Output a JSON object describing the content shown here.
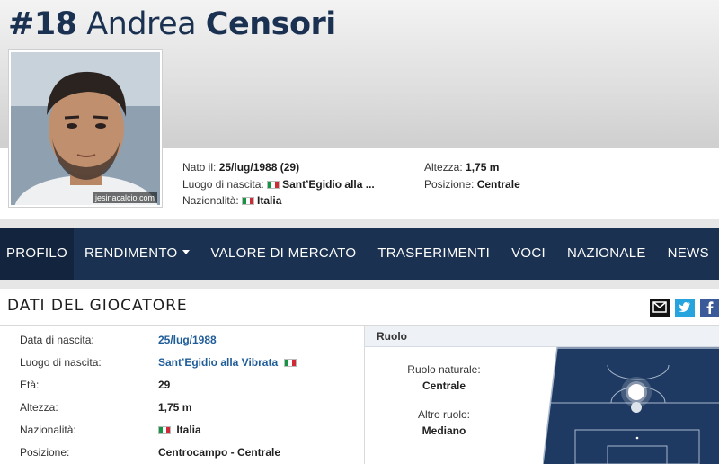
{
  "player": {
    "number": "#18",
    "first_name": "Andrea",
    "last_name": "Censori",
    "photo_credit": "jesinacalcio.com"
  },
  "header_facts": {
    "left": [
      {
        "label": "Nato il:",
        "value": "25/lug/1988 (29)",
        "flag": false
      },
      {
        "label": "Luogo di nascita:",
        "value": "Sant’Egidio alla ...",
        "flag": true
      },
      {
        "label": "Nazionalità:",
        "value": "Italia",
        "flag": true
      }
    ],
    "right": [
      {
        "label": "Altezza:",
        "value": "1,75 m"
      },
      {
        "label": "Posizione:",
        "value": "Centrale"
      }
    ]
  },
  "nav": {
    "items": [
      "PROFILO",
      "RENDIMENTO",
      "VALORE DI MERCATO",
      "TRASFERIMENTI",
      "VOCI",
      "NAZIONALE",
      "NEWS"
    ],
    "active": "PROFILO"
  },
  "section": {
    "title": "DATI DEL GIOCATORE"
  },
  "details": [
    {
      "label": "Data di nascita:",
      "value": "25/lug/1988"
    },
    {
      "label": "Luogo di nascita:",
      "value": "Sant’Egidio alla Vibrata"
    },
    {
      "label": "Età:",
      "value": "29"
    },
    {
      "label": "Altezza:",
      "value": "1,75 m"
    },
    {
      "label": "Nazionalità:",
      "value": "Italia"
    },
    {
      "label": "Posizione:",
      "value": "Centrocampo - Centrale"
    }
  ],
  "ruolo": {
    "heading": "Ruolo",
    "natural_label": "Ruolo naturale:",
    "natural_value": "Centrale",
    "other_label": "Altro ruolo:",
    "other_value": "Mediano"
  },
  "colors": {
    "nav_bg": "#1a3151",
    "link": "#1f5d99",
    "pitch": "#1e3a62",
    "twitter": "#27a3dd",
    "facebook": "#3b5a99"
  },
  "icons": [
    "mail-icon",
    "twitter-icon",
    "facebook-icon",
    "caret-down-icon",
    "italy-flag-icon"
  ]
}
